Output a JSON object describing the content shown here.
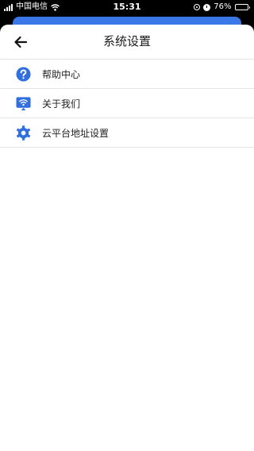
{
  "status_bar": {
    "carrier": "中国电信",
    "time": "15:31",
    "battery": "76%",
    "battery_level": 0.76
  },
  "header": {
    "title": "系统设置",
    "back_icon": "arrow-left-icon"
  },
  "menu": {
    "items": [
      {
        "label": "帮助中心",
        "icon": "question-circle-icon"
      },
      {
        "label": "关于我们",
        "icon": "wifi-monitor-icon"
      },
      {
        "label": "云平台地址设置",
        "icon": "gear-icon"
      }
    ]
  },
  "colors": {
    "accent": "#2f6fe0",
    "background_card": "#3b77e6",
    "battery_fill": "#4cd964"
  }
}
